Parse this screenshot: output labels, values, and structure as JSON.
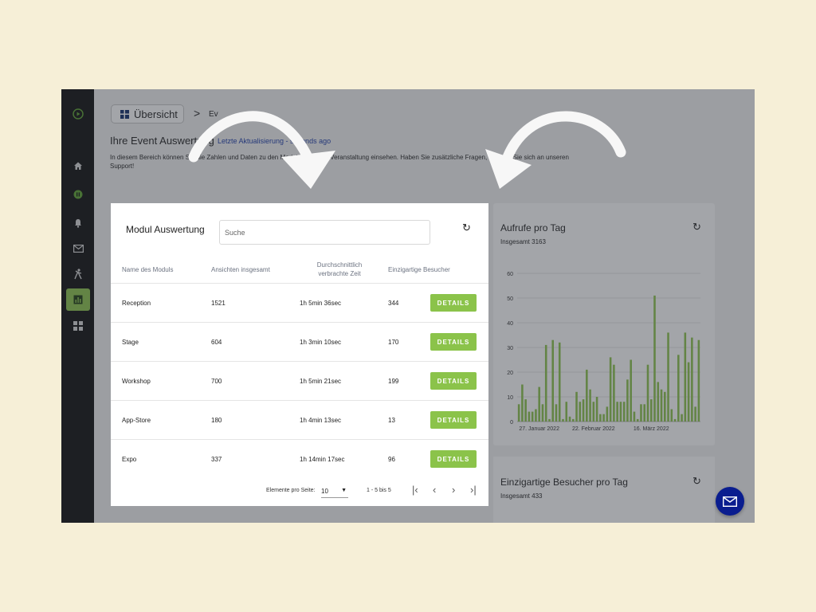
{
  "breadcrumb": {
    "home_label": "Übersicht",
    "separator": ">",
    "current": "Ev"
  },
  "header": {
    "title": "Ihre Event Auswertung",
    "last_update": "Letzte Aktualisierung - seconds ago",
    "description": "In diesem Bereich können Sie die Zahlen und Daten zu den Modulen an Ihrer Veranstaltung einsehen. Haben Sie zusätzliche Fragen, wenden Sie sich an unseren Support!"
  },
  "sidebar": {
    "icons": [
      "logo-icon",
      "home-icon",
      "live-icon",
      "bell-icon",
      "mail-icon",
      "person-icon",
      "analytics-icon",
      "grid-icon"
    ],
    "active": "analytics-icon"
  },
  "modules": {
    "title": "Modul Auswertung",
    "search_placeholder": "Suche",
    "columns": [
      "Name des Moduls",
      "Ansichten insgesamt",
      "Durchschnittlich verbrachte Zeit",
      "Einzigartige Besucher"
    ],
    "rows": [
      {
        "name": "Reception",
        "views": "1521",
        "time": "1h 5min 36sec",
        "visitors": "344"
      },
      {
        "name": "Stage",
        "views": "604",
        "time": "1h 3min 10sec",
        "visitors": "170"
      },
      {
        "name": "Workshop",
        "views": "700",
        "time": "1h 5min 21sec",
        "visitors": "199"
      },
      {
        "name": "App-Store",
        "views": "180",
        "time": "1h 4min 13sec",
        "visitors": "13"
      },
      {
        "name": "Expo",
        "views": "337",
        "time": "1h 14min 17sec",
        "visitors": "96"
      }
    ],
    "details_label": "DETAILS",
    "pagination": {
      "per_page_label": "Elemente pro Seite:",
      "per_page": "10",
      "range": "1 - 5 bis 5"
    }
  },
  "calls_card": {
    "title": "Aufrufe pro Tag",
    "total": "Insgesamt 3163"
  },
  "visitors_card": {
    "title": "Einzigartige Besucher pro Tag",
    "total": "Insgesamt 433"
  },
  "colors": {
    "accent": "#8bc34a",
    "fab": "#0a1d8f",
    "sidebar": "#0b0b0b",
    "background": "#f6efd7"
  },
  "chart_data": {
    "type": "bar",
    "ylim": [
      0,
      60
    ],
    "yticks": [
      0,
      10,
      20,
      30,
      40,
      50,
      60
    ],
    "xtick_labels": [
      "27. Januar 2022",
      "22. Februar 2022",
      "16. März 2022"
    ],
    "xtick_index": [
      6,
      22,
      39
    ],
    "grid": true,
    "values": [
      7,
      15,
      9,
      4,
      4,
      5,
      14,
      7,
      31,
      1,
      33,
      7,
      32,
      1,
      8,
      2,
      1,
      12,
      8,
      9,
      21,
      13,
      8,
      10,
      3,
      3,
      6,
      26,
      23,
      8,
      8,
      8,
      17,
      25,
      4,
      1,
      7,
      7,
      23,
      9,
      51,
      16,
      13,
      12,
      36,
      5,
      1,
      27,
      3,
      36,
      24,
      34,
      6,
      33
    ]
  }
}
